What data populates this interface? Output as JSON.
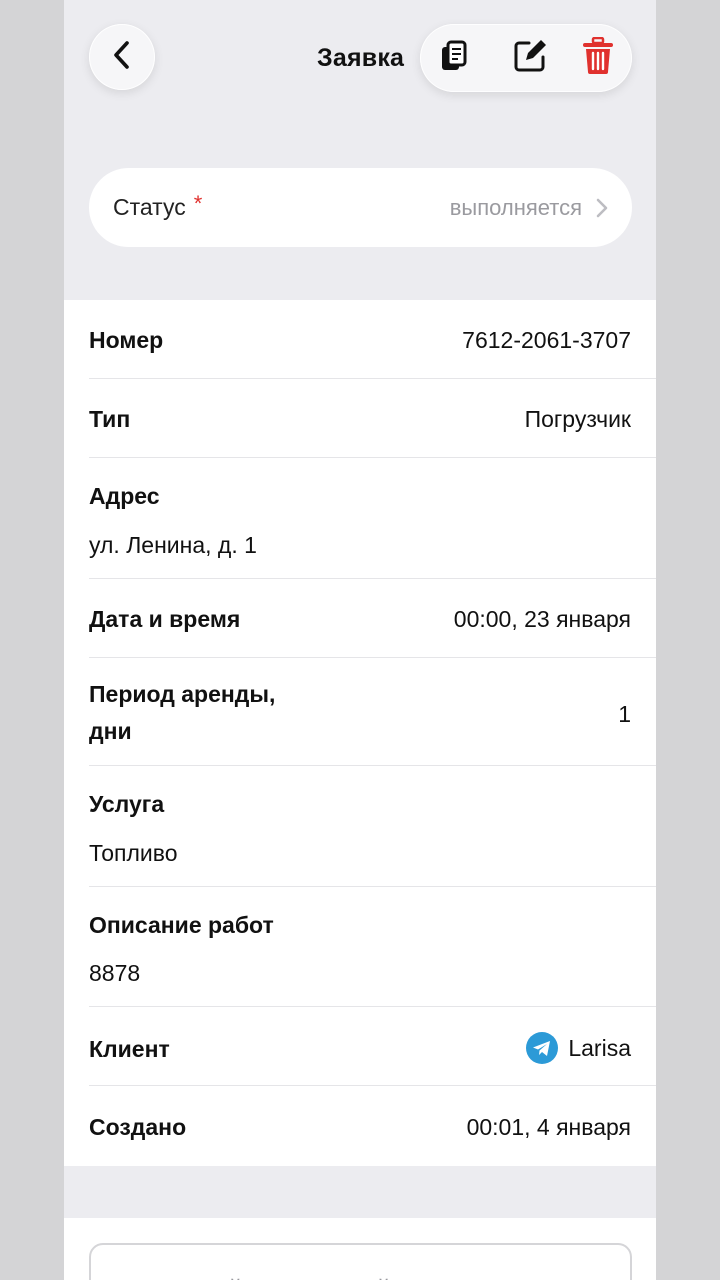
{
  "header": {
    "title": "Заявка",
    "icons": {
      "back": "chevron-left-icon",
      "copy": "copy-icon",
      "edit": "edit-icon",
      "delete": "trash-icon"
    },
    "delete_color": "#e0312e"
  },
  "status": {
    "label": "Статус",
    "required_mark": "*",
    "value": "выполняется"
  },
  "details": {
    "number": {
      "label": "Номер",
      "value": "7612-2061-3707"
    },
    "type": {
      "label": "Тип",
      "value": "Погрузчик"
    },
    "address": {
      "label": "Адрес",
      "value": "ул. Ленина, д. 1"
    },
    "datetime": {
      "label": "Дата и время",
      "value": "00:00, 23 января"
    },
    "period": {
      "label_line1": "Период аренды,",
      "label_line2": "дни",
      "value": "1"
    },
    "service": {
      "label": "Услуга",
      "value": "Топливо"
    },
    "work": {
      "label": "Описание работ",
      "value": "8878"
    },
    "client": {
      "label": "Клиент",
      "value": "Larisa",
      "icon": "telegram-icon",
      "link_color": "#2c9ad7"
    },
    "created": {
      "label": "Создано",
      "value": "00:01, 4 января"
    }
  },
  "comment": {
    "placeholder": "Внутренний комментарий"
  }
}
